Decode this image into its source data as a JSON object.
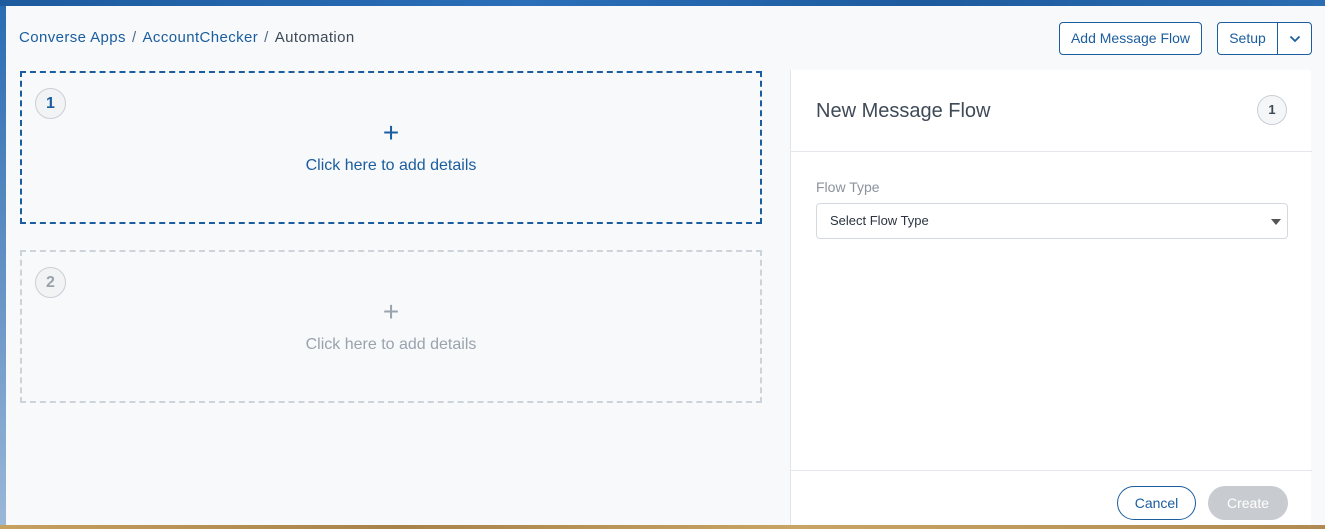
{
  "breadcrumb": {
    "items": [
      "Converse Apps",
      "AccountChecker",
      "Automation"
    ],
    "separator": "/"
  },
  "header": {
    "add_flow_label": "Add Message Flow",
    "setup_label": "Setup"
  },
  "steps": [
    {
      "number": "1",
      "add_label": "Click here to add details",
      "state": "active"
    },
    {
      "number": "2",
      "add_label": "Click here to add details",
      "state": "inactive"
    }
  ],
  "plus_glyph": "+",
  "panel": {
    "title": "New Message Flow",
    "badge": "1",
    "flow_type_label": "Flow Type",
    "flow_type_value": "Select Flow Type",
    "cancel_label": "Cancel",
    "create_label": "Create"
  },
  "colors": {
    "accent": "#1b5d9e",
    "disabled_button": "#c8cbcf"
  },
  "icons": {
    "setup_dropdown": "chevron-down-icon",
    "add_step": "plus-icon",
    "select_caret": "caret-down-icon"
  }
}
